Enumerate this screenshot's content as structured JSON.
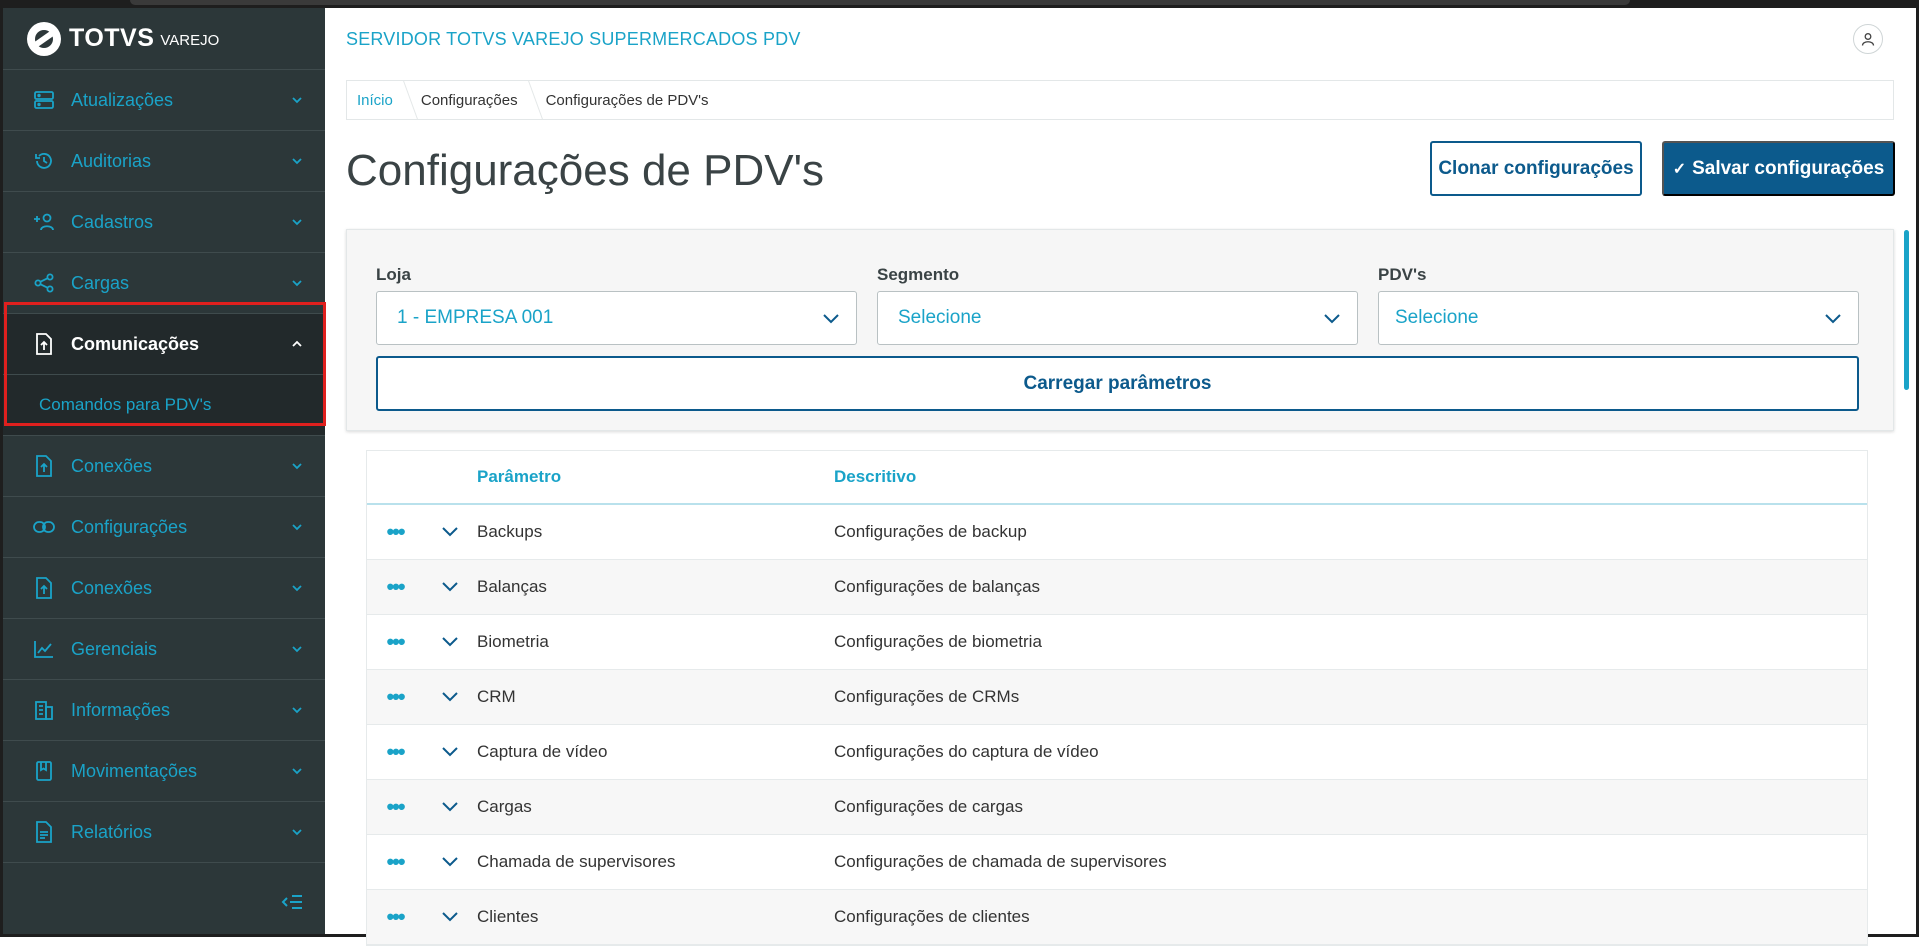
{
  "brand": {
    "name": "TOTVS",
    "sub": "VAREJO"
  },
  "sidebar": {
    "items": [
      {
        "label": "Atualizações",
        "icon": "server-icon"
      },
      {
        "label": "Auditorias",
        "icon": "history-icon"
      },
      {
        "label": "Cadastros",
        "icon": "add-user-icon"
      },
      {
        "label": "Cargas",
        "icon": "share-icon"
      },
      {
        "label": "Comunicações",
        "icon": "upload-file-icon",
        "expanded": true,
        "children": [
          {
            "label": "Comandos para PDV's"
          }
        ]
      },
      {
        "label": "Conexões",
        "icon": "upload-file-icon"
      },
      {
        "label": "Configurações",
        "icon": "link-icon"
      },
      {
        "label": "Conexões",
        "icon": "upload-file-icon"
      },
      {
        "label": "Gerenciais",
        "icon": "chart-icon"
      },
      {
        "label": "Informações",
        "icon": "building-icon"
      },
      {
        "label": "Movimentações",
        "icon": "book-icon"
      },
      {
        "label": "Relatórios",
        "icon": "document-icon"
      }
    ]
  },
  "header": {
    "title": "SERVIDOR TOTVS VAREJO SUPERMERCADOS PDV"
  },
  "breadcrumb": [
    "Início",
    "Configurações",
    "Configurações de PDV's"
  ],
  "page": {
    "title": "Configurações de PDV's",
    "clone_label": "Clonar configurações",
    "save_label": "Salvar configurações"
  },
  "filters": {
    "loja": {
      "label": "Loja",
      "value": "1 - EMPRESA 001"
    },
    "segmento": {
      "label": "Segmento",
      "value": "Selecione"
    },
    "pdvs": {
      "label": "PDV's",
      "value": "Selecione"
    },
    "load_label": "Carregar parâmetros"
  },
  "table": {
    "headers": {
      "param": "Parâmetro",
      "desc": "Descritivo"
    },
    "rows": [
      {
        "param": "Backups",
        "desc": "Configurações de backup"
      },
      {
        "param": "Balanças",
        "desc": "Configurações de balanças"
      },
      {
        "param": "Biometria",
        "desc": "Configurações de biometria"
      },
      {
        "param": "CRM",
        "desc": "Configurações de CRMs"
      },
      {
        "param": "Captura de vídeo",
        "desc": "Configurações do captura de vídeo"
      },
      {
        "param": "Cargas",
        "desc": "Configurações de cargas"
      },
      {
        "param": "Chamada de supervisores",
        "desc": "Configurações de chamada de supervisores"
      },
      {
        "param": "Clientes",
        "desc": "Configurações de clientes"
      }
    ]
  },
  "colors": {
    "accent": "#1aa3c8",
    "primary": "#0c5a8c",
    "sidebar_bg": "#2c3739",
    "highlight": "#e0201e"
  }
}
